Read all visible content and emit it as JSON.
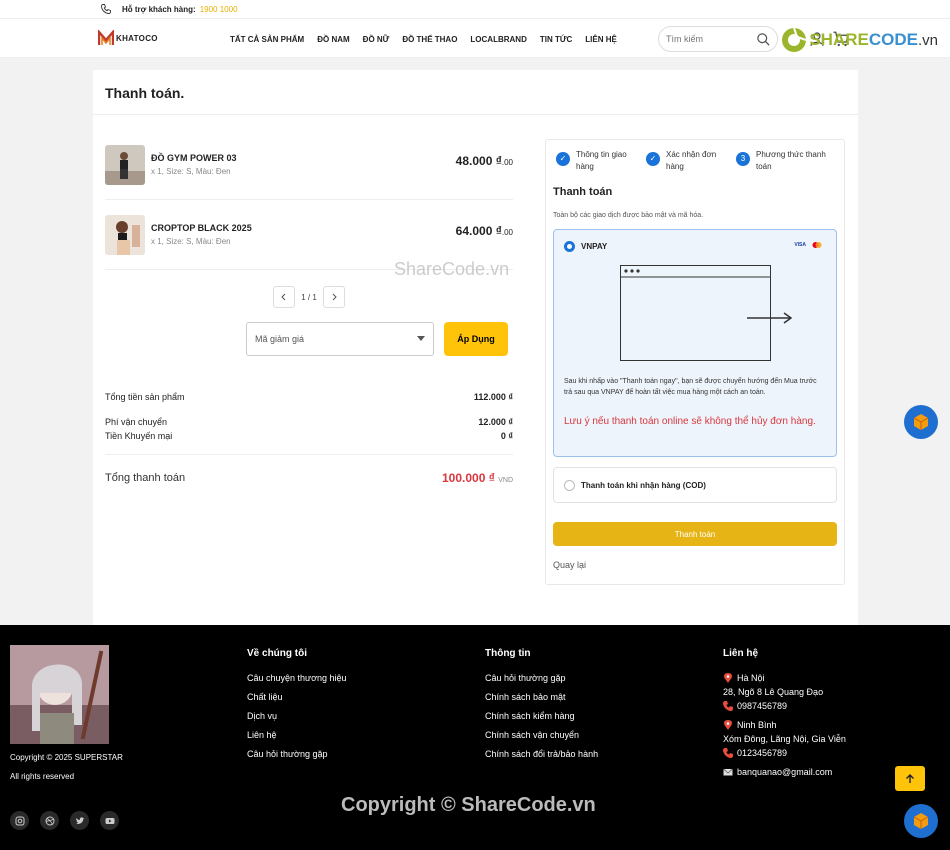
{
  "topbar": {
    "support_label": "Hỗ trợ khách hàng:",
    "hotline": "1900 1000"
  },
  "header": {
    "logo_text": "KHATOCO",
    "nav": [
      "TẤT CẢ SẢN PHẨM",
      "ĐỒ NAM",
      "ĐỒ NỮ",
      "ĐỒ THỂ THAO",
      "LOCALBRAND",
      "TIN TỨC",
      "LIÊN HỆ"
    ],
    "search_placeholder": "Tìm kiếm"
  },
  "brandmark": {
    "share": "SHARE",
    "code": "CODE",
    "vn": ".vn"
  },
  "page": {
    "title": "Thanh toán."
  },
  "cart": {
    "items": [
      {
        "name": "ĐỒ GYM POWER 03",
        "meta": "x 1, Size: S, Màu: Đen",
        "price": "48.000 ₫",
        "decimals": ".00"
      },
      {
        "name": "CROPTOP BLACK 2025",
        "meta": "x 1, Size: S, Màu: Đen",
        "price": "64.000 ₫",
        "decimals": ".00"
      }
    ],
    "pager": "1 / 1",
    "coupon_placeholder": "Mã giảm giá",
    "apply_label": "Áp Dụng",
    "summary": {
      "subtotal_label": "Tổng tiền sản phẩm",
      "subtotal": "112.000 ₫",
      "shipping_label": "Phí vận chuyển",
      "shipping": "12.000 ₫",
      "discount_label": "Tiền Khuyến mại",
      "discount": "0 ₫",
      "total_label": "Tổng thanh toán",
      "total": "100.000 ₫",
      "currency": "VND"
    }
  },
  "checkout": {
    "steps": [
      {
        "label": "Thông tin giao hàng",
        "state": "done"
      },
      {
        "label": "Xác nhận đơn hàng",
        "state": "done"
      },
      {
        "label": "Phương thức thanh toán",
        "state": "current",
        "number": "3"
      }
    ],
    "heading": "Thanh toán",
    "note": "Toàn bộ các giao dịch được bảo mật và mã hóa.",
    "vnpay": {
      "label": "VNPAY",
      "card_brand": "VISA",
      "description": "Sau khi nhấp vào \"Thanh toán ngay\", bạn sẽ được chuyển hướng đến Mua trước trả sau qua VNPAY để hoàn tất việc mua hàng một cách an toàn.",
      "warning": "Lưu ý nếu thanh toán online sẽ không thể hủy đơn hàng."
    },
    "cod_label": "Thanh toán khi nhận hàng (COD)",
    "pay_button": "Thanh toán",
    "back_link": "Quay lại"
  },
  "footer": {
    "copyright": "Copyright © 2025 SUPERSTAR",
    "rights": "All rights reserved",
    "about": {
      "title": "Về chúng tôi",
      "links": [
        "Câu chuyện thương hiệu",
        "Chất liệu",
        "Dịch vụ",
        "Liên hệ",
        "Câu hỏi thường gặp"
      ]
    },
    "info": {
      "title": "Thông tin",
      "links": [
        "Câu hỏi thường gặp",
        "Chính sách bảo mật",
        "Chính sách kiểm hàng",
        "Chính sách vận chuyển",
        "Chính sách đổi trả/bảo hành"
      ]
    },
    "contact": {
      "title": "Liên hệ",
      "branches": [
        {
          "city": "Hà Nội",
          "address": "28, Ngõ 8 Lê Quang Đạo",
          "phone": "0987456789"
        },
        {
          "city": "Ninh Bình",
          "address": "Xóm Đông, Lãng Nội, Gia Viễn",
          "phone": "0123456789"
        }
      ],
      "email": "banquanao@gmail.com"
    },
    "watermark": "Copyright © ShareCode.vn"
  },
  "overlay_watermark": "ShareCode.vn",
  "colors": {
    "accent": "#ffc40a",
    "primary": "#1a73d9",
    "danger": "#d9363e",
    "footer_bg": "#000000"
  }
}
